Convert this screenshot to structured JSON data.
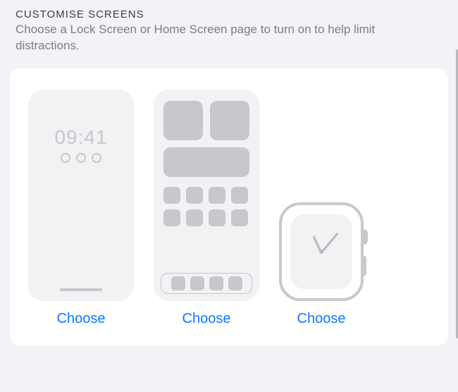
{
  "header": {
    "title": "CUSTOMISE SCREENS",
    "description": "Choose a Lock Screen or Home Screen page to turn on to help limit distractions."
  },
  "lockScreen": {
    "time": "09:41",
    "chooseLabel": "Choose"
  },
  "homeScreen": {
    "chooseLabel": "Choose"
  },
  "watch": {
    "chooseLabel": "Choose"
  }
}
